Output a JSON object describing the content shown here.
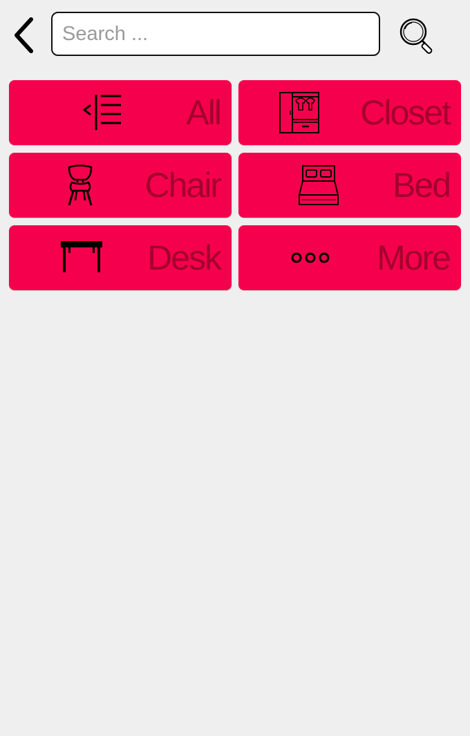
{
  "header": {
    "back_icon": "chevron-left-icon",
    "search": {
      "placeholder": "Search ...",
      "value": ""
    },
    "search_icon": "magnifier-icon"
  },
  "categories": [
    {
      "label": "All",
      "icon": "list-indent-icon"
    },
    {
      "label": "Closet",
      "icon": "wardrobe-icon"
    },
    {
      "label": "Chair",
      "icon": "chair-icon"
    },
    {
      "label": "Bed",
      "icon": "bed-icon"
    },
    {
      "label": "Desk",
      "icon": "desk-icon"
    },
    {
      "label": "More",
      "icon": "more-dots-icon"
    }
  ],
  "colors": {
    "background": "#efefef",
    "tile": "#f5004c",
    "tile_label": "#a3002f"
  }
}
